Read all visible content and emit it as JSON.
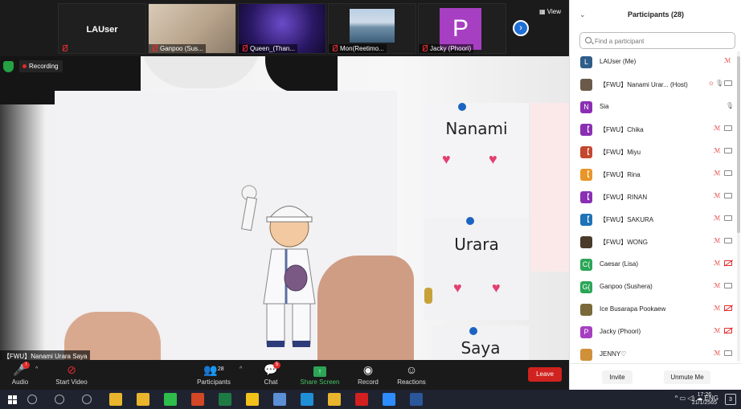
{
  "thumbnails": [
    {
      "name": "",
      "display": "LAUser"
    },
    {
      "name": "Ganpoo (Sus..."
    },
    {
      "name": "Queen_(Than..."
    },
    {
      "name": "Mon(Reetimo..."
    },
    {
      "name": "Jacky (Phoori)",
      "avatar_letter": "P",
      "avatar_color": "#a63fc1"
    }
  ],
  "view_label": "View",
  "recording_label": "Recording",
  "speaker_label": "【FWU】Nanami Urara Saya",
  "wall_cards": [
    "Nanami",
    "Urara",
    "Saya"
  ],
  "toolbar": {
    "audio": "Audio",
    "start_video": "Start Video",
    "participants": "Participants",
    "participants_count": "28",
    "chat": "Chat",
    "chat_badge": "5",
    "audio_badge": "!",
    "share": "Share Screen",
    "record": "Record",
    "reactions": "Reactions",
    "leave": "Leave"
  },
  "panel": {
    "title": "Participants (28)",
    "search_placeholder": "Find a participant",
    "participants": [
      {
        "initial": "L",
        "color": "#2f5d8a",
        "name": "LAUser (Me)",
        "mic": "off",
        "cam": "none"
      },
      {
        "initial": "",
        "color": "#6b5a4a",
        "name": "【FWU】Nanami Urar... (Host)",
        "mic": "on",
        "cam": "on",
        "share": true
      },
      {
        "initial": "N",
        "color": "#8a2fb3",
        "name": "Sia",
        "mic": "on",
        "cam": "none"
      },
      {
        "initial": "【",
        "color": "#8a2fb3",
        "name": "【FWU】Chika",
        "mic": "off",
        "cam": "on"
      },
      {
        "initial": "【",
        "color": "#c4472f",
        "name": "【FWU】Miyu",
        "mic": "off",
        "cam": "on"
      },
      {
        "initial": "【",
        "color": "#e8962a",
        "name": "【FWU】Rina",
        "mic": "off",
        "cam": "on"
      },
      {
        "initial": "【",
        "color": "#8a2fb3",
        "name": "【FWU】RINAN",
        "mic": "off",
        "cam": "on"
      },
      {
        "initial": "【",
        "color": "#1f73b7",
        "name": "【FWU】SAKURA",
        "mic": "off",
        "cam": "on"
      },
      {
        "initial": "",
        "color": "#4a3a2a",
        "name": "【FWU】WONG",
        "mic": "off",
        "cam": "on"
      },
      {
        "initial": "C(",
        "color": "#2ba656",
        "name": "Caesar (Lisa)",
        "mic": "off",
        "cam": "off"
      },
      {
        "initial": "G(",
        "color": "#2ba656",
        "name": "Ganpoo (Sushera)",
        "mic": "off",
        "cam": "on"
      },
      {
        "initial": "",
        "color": "#7a6a3a",
        "name": "Ice Busarapa Pookaew",
        "mic": "off",
        "cam": "off"
      },
      {
        "initial": "P",
        "color": "#a63fc1",
        "name": "Jacky (Phoori)",
        "mic": "off",
        "cam": "off"
      },
      {
        "initial": "",
        "color": "#d0903a",
        "name": "JENNY♡",
        "mic": "off",
        "cam": "on"
      }
    ],
    "invite": "Invite",
    "unmute_me": "Unmute Me"
  },
  "taskbar": {
    "language": "ENG",
    "time": "17:26",
    "date": "21/1/2565",
    "notifications": "3",
    "apps": [
      "search-icon",
      "task-view-icon",
      "widgets-icon",
      "chrome-icon",
      "file-explorer-icon",
      "line-icon",
      "powerpoint-icon",
      "excel-icon",
      "sticky-notes-icon",
      "notepad-icon",
      "edge-icon",
      "chrome-icon",
      "acrobat-icon",
      "zoom-icon",
      "word-icon"
    ]
  }
}
